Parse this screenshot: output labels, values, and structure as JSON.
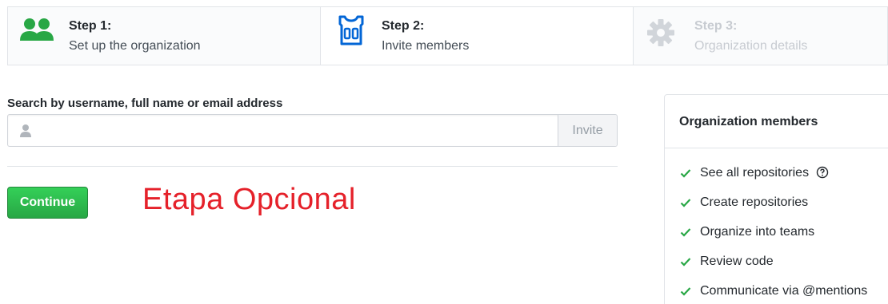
{
  "steps": [
    {
      "title": "Step 1:",
      "subtitle": "Set up the organization",
      "icon": "people-icon",
      "state": "complete"
    },
    {
      "title": "Step 2:",
      "subtitle": "Invite members",
      "icon": "jersey-icon",
      "state": "current"
    },
    {
      "title": "Step 3:",
      "subtitle": "Organization details",
      "icon": "gear-icon",
      "state": "upcoming"
    }
  ],
  "search": {
    "label": "Search by username, full name or email address",
    "value": "",
    "placeholder": "",
    "icon": "person-icon",
    "invite_label": "Invite"
  },
  "continue_label": "Continue",
  "optional_note": "Etapa Opcional",
  "members_panel": {
    "title": "Organization members",
    "permissions": [
      {
        "label": "See all repositories",
        "icon": "check-icon",
        "help_icon": "question-icon"
      },
      {
        "label": "Create repositories",
        "icon": "check-icon"
      },
      {
        "label": "Organize into teams",
        "icon": "check-icon"
      },
      {
        "label": "Review code",
        "icon": "check-icon"
      },
      {
        "label": "Communicate via @mentions",
        "icon": "check-icon"
      }
    ]
  },
  "colors": {
    "accent_green": "#28a745",
    "accent_blue": "#0366d6",
    "note_red": "#e5212a",
    "disabled_gray": "#c7cbd1"
  }
}
